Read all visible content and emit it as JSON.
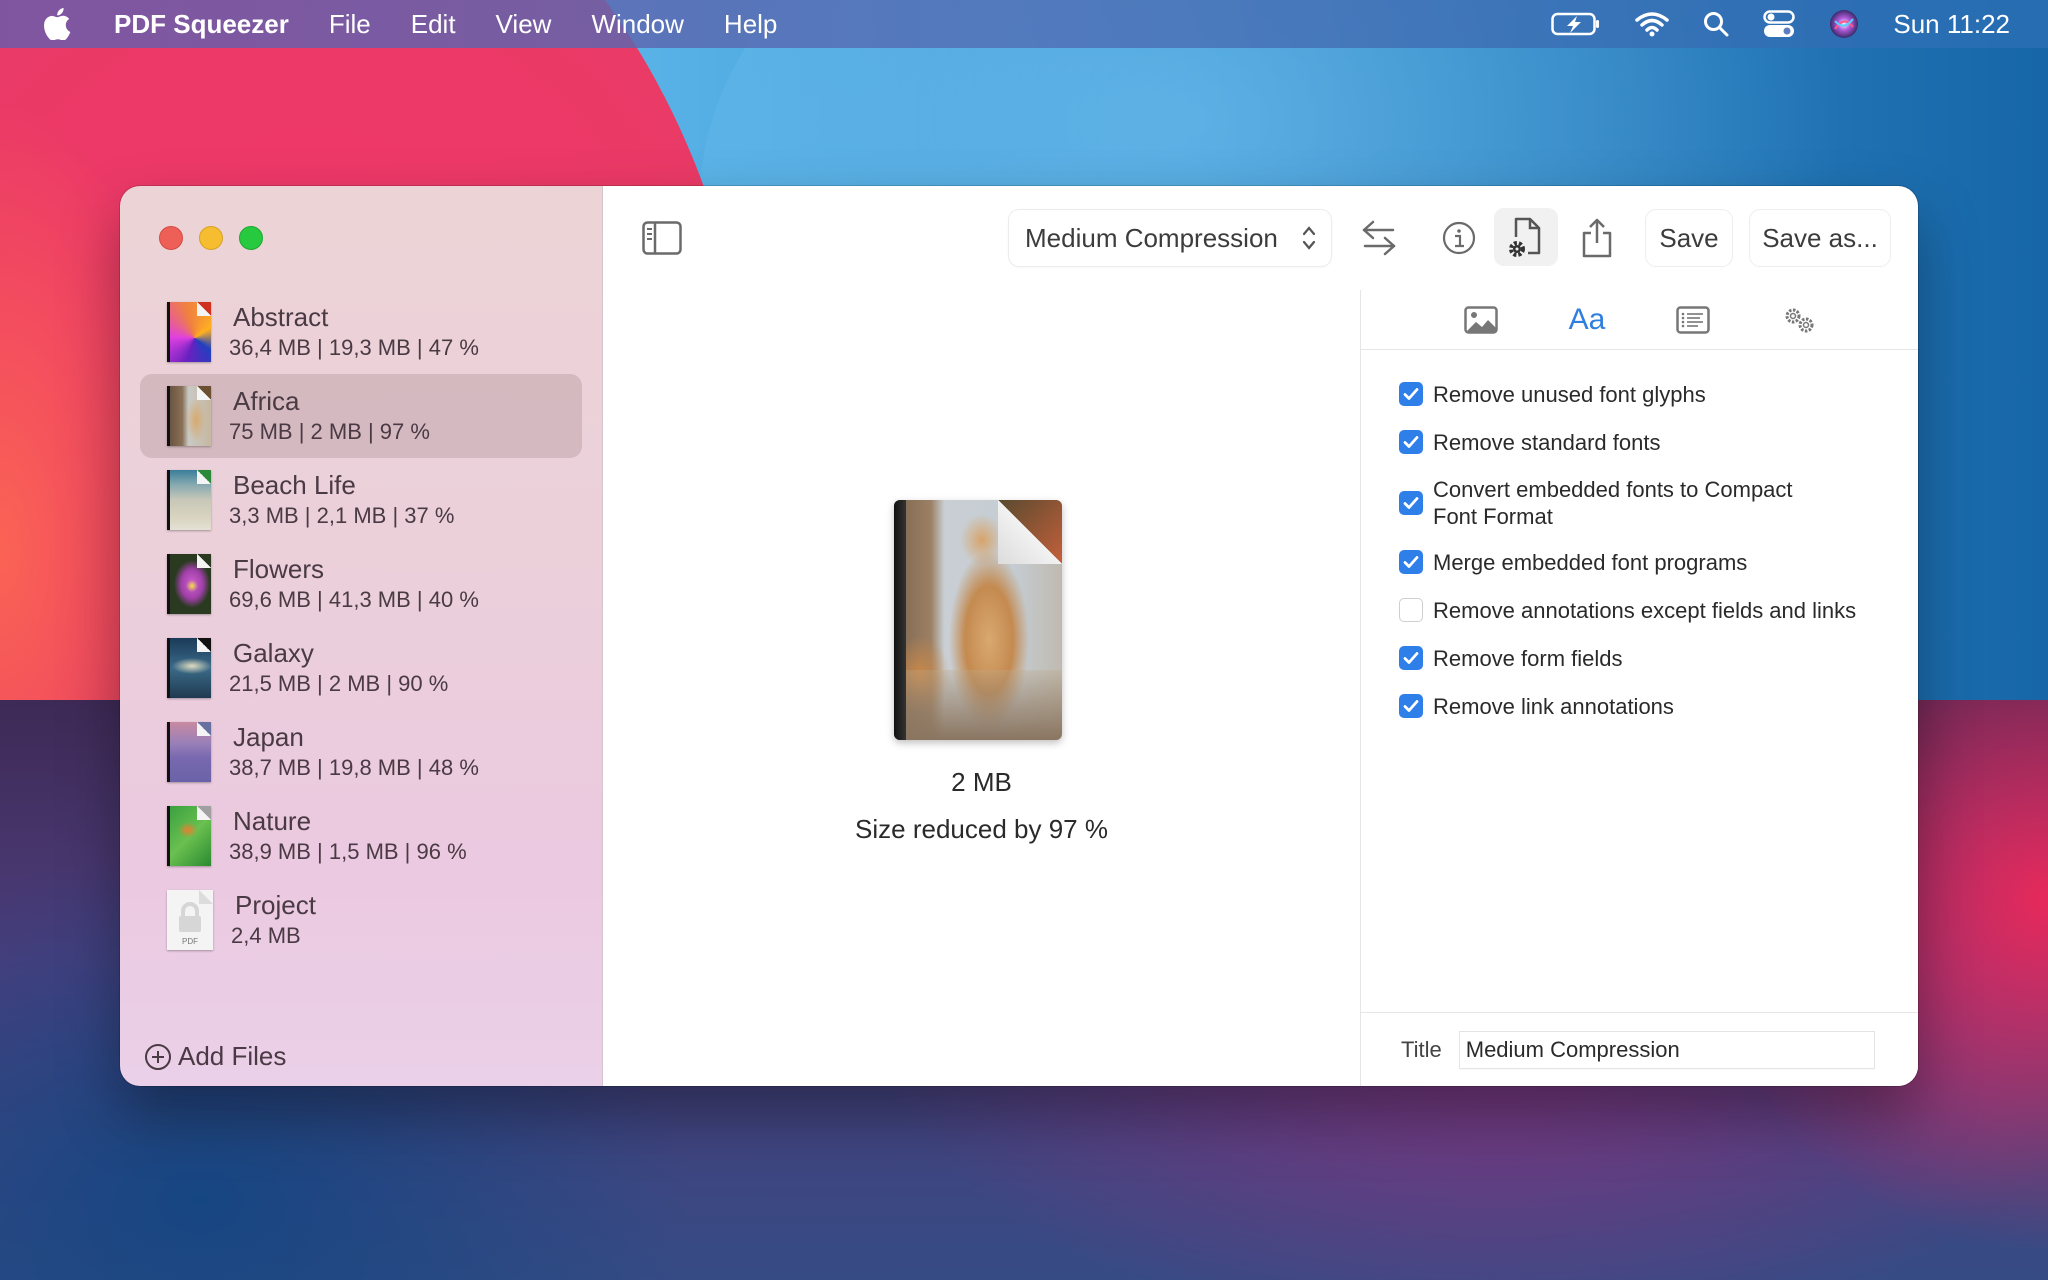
{
  "menubar": {
    "app_name": "PDF Squeezer",
    "menus": [
      "File",
      "Edit",
      "View",
      "Window",
      "Help"
    ],
    "status_icons": [
      "battery-charging-icon",
      "wifi-icon",
      "spotlight-search-icon",
      "control-center-icon",
      "siri-icon"
    ],
    "clock": "Sun 11:22"
  },
  "window": {
    "traffic_lights": {
      "close": "#ed5f57",
      "minimize": "#f5bd2f",
      "maximize": "#27c93f"
    }
  },
  "sidebar": {
    "files": [
      {
        "name": "Abstract",
        "meta": "36,4 MB | 19,3 MB | 47 %",
        "selected": false
      },
      {
        "name": "Africa",
        "meta": "75 MB | 2 MB | 97 %",
        "selected": true
      },
      {
        "name": "Beach Life",
        "meta": "3,3 MB | 2,1 MB | 37 %",
        "selected": false
      },
      {
        "name": "Flowers",
        "meta": "69,6 MB | 41,3 MB | 40 %",
        "selected": false
      },
      {
        "name": "Galaxy",
        "meta": "21,5 MB | 2 MB | 90 %",
        "selected": false
      },
      {
        "name": "Japan",
        "meta": "38,7 MB | 19,8 MB | 48 %",
        "selected": false
      },
      {
        "name": "Nature",
        "meta": "38,9 MB | 1,5 MB | 96 %",
        "selected": false
      },
      {
        "name": "Project",
        "meta": "2,4 MB",
        "selected": false,
        "locked_label": "PDF"
      }
    ],
    "add_files_label": "Add Files"
  },
  "toolbar": {
    "preset": "Medium Compression",
    "save_label": "Save",
    "save_as_label": "Save as..."
  },
  "preview": {
    "size": "2 MB",
    "reduced": "Size reduced by 97 %"
  },
  "inspector": {
    "tabs": [
      {
        "name": "images",
        "icon": "image-icon",
        "active": false
      },
      {
        "name": "fonts",
        "label": "Aa",
        "active": true
      },
      {
        "name": "document",
        "icon": "list-icon",
        "active": false
      },
      {
        "name": "advanced",
        "icon": "gears-icon",
        "active": false
      }
    ],
    "options": [
      {
        "label": "Remove unused font glyphs",
        "checked": true
      },
      {
        "label": "Remove standard fonts",
        "checked": true
      },
      {
        "label": "Convert embedded fonts to Compact Font Format",
        "checked": true
      },
      {
        "label": "Merge embedded font programs",
        "checked": true
      },
      {
        "label": "Remove annotations except fields and links",
        "checked": false
      },
      {
        "label": "Remove form fields",
        "checked": true
      },
      {
        "label": "Remove link annotations",
        "checked": true
      }
    ],
    "title_label": "Title",
    "title_value": "Medium Compression",
    "accent": "#2f7fe8"
  }
}
